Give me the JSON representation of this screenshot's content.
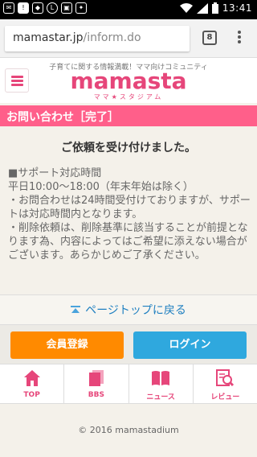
{
  "status_bar": {
    "time": "13:41",
    "left_icons": [
      "mail-icon",
      "alert-icon",
      "shield-icon",
      "line-icon",
      "bag-icon",
      "clean-icon"
    ],
    "right_icons": [
      "wifi-icon",
      "signal-icon",
      "battery-icon"
    ]
  },
  "browser": {
    "url_domain": "mamastar.jp",
    "url_path": "/inform.do",
    "tab_count": "8"
  },
  "site_header": {
    "tagline": "子育てに関する情報満載！ママ向けコミュニティ",
    "logo": "mamasta",
    "logo_sub": "ママ★スタジアム",
    "brand_color": "#e6467a"
  },
  "page": {
    "title": "お問い合わせ［完了］",
    "headline": "ご依頼を受け付けました。",
    "info_lines": [
      "■サポート対応時間",
      "平日10:00〜18:00（年末年始は除く）",
      "・お問合わせは24時間受付けておりますが、サポートは対応時間内となります。",
      "・削除依頼は、削除基準に該当することが前提となります為、内容によってはご希望に添えない場合がございます。あらかじめご了承ください。"
    ],
    "pagetop_label": "ページトップに戻る"
  },
  "buttons": {
    "register_label": "会員登録",
    "login_label": "ログイン",
    "register_color": "#ff8a00",
    "login_color": "#2fa8de"
  },
  "nav": {
    "items": [
      {
        "label": "TOP",
        "icon": "home-icon"
      },
      {
        "label": "BBS",
        "icon": "bbs-icon"
      },
      {
        "label": "ニュース",
        "icon": "book-icon"
      },
      {
        "label": "レビュー",
        "icon": "review-icon"
      }
    ]
  },
  "footer": {
    "copyright": "© 2016 mamastadium"
  }
}
